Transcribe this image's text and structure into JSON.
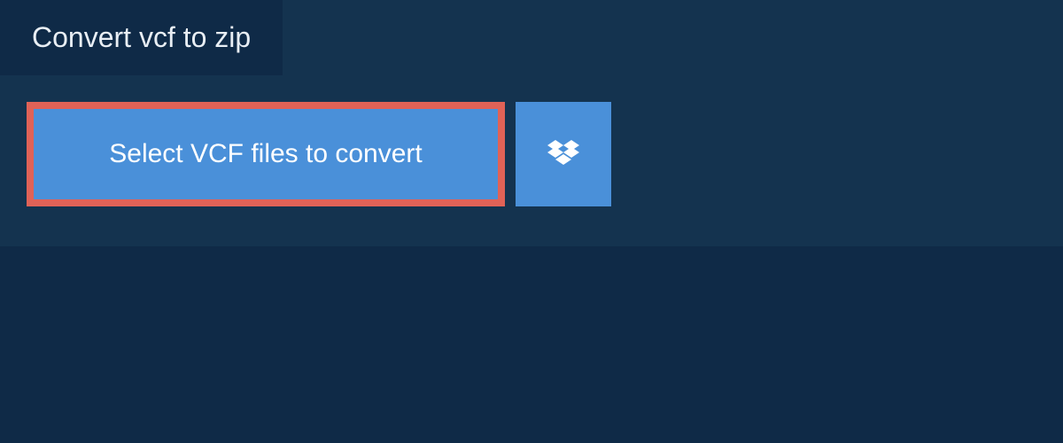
{
  "header": {
    "title": "Convert vcf to zip"
  },
  "actions": {
    "select_label": "Select VCF files to convert"
  },
  "colors": {
    "background": "#0f2a47",
    "panel": "#14334f",
    "button_primary": "#4a90d9",
    "button_highlight_border": "#e06257"
  }
}
